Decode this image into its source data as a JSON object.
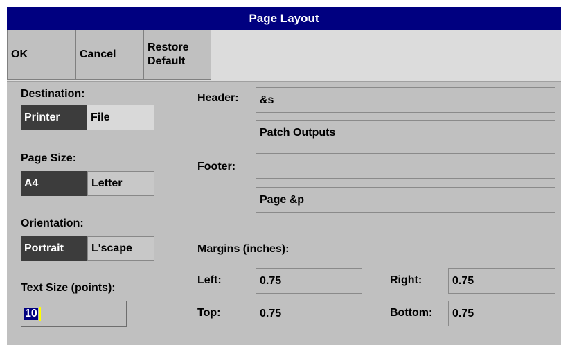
{
  "window": {
    "title": "Page Layout"
  },
  "toolbar": {
    "ok_label": "OK",
    "cancel_label": "Cancel",
    "restore_label": "Restore\nDefault"
  },
  "destination": {
    "label": "Destination:",
    "options": [
      "Printer",
      "File"
    ],
    "selected": "Printer"
  },
  "page_size": {
    "label": "Page Size:",
    "options": [
      "A4",
      "Letter"
    ],
    "selected": "A4"
  },
  "orientation": {
    "label": "Orientation:",
    "options": [
      "Portrait",
      "L'scape"
    ],
    "selected": "Portrait"
  },
  "text_size": {
    "label": "Text Size (points):",
    "value": "10"
  },
  "header": {
    "label": "Header:",
    "line1": "&s",
    "line2": "Patch Outputs"
  },
  "footer": {
    "label": "Footer:",
    "line1": "",
    "line2": "Page &p"
  },
  "margins": {
    "label": "Margins (inches):",
    "left_label": "Left:",
    "left": "0.75",
    "right_label": "Right:",
    "right": "0.75",
    "top_label": "Top:",
    "top": "0.75",
    "bottom_label": "Bottom:",
    "bottom": "0.75"
  }
}
